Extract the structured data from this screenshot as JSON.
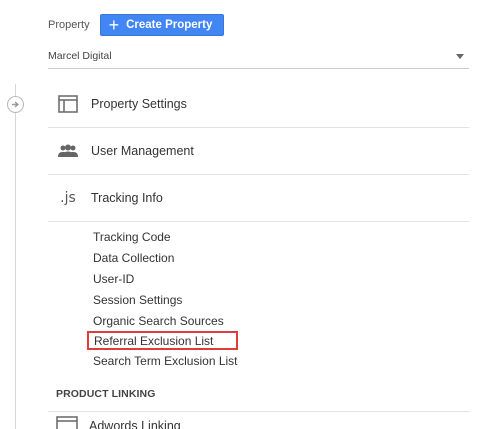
{
  "property": {
    "label": "Property",
    "create_button": "Create Property",
    "selected": "Marcel Digital"
  },
  "sections": [
    {
      "label": "Property Settings",
      "icon": "layout-icon"
    },
    {
      "label": "User Management",
      "icon": "people-icon"
    },
    {
      "label": "Tracking Info",
      "icon": "js-icon",
      "icon_text": ".js"
    }
  ],
  "tracking_items": [
    "Tracking Code",
    "Data Collection",
    "User-ID",
    "Session Settings",
    "Organic Search Sources",
    "Referral Exclusion List",
    "Search Term Exclusion List"
  ],
  "product_linking": {
    "heading": "PRODUCT LINKING",
    "first_item": "Adwords Linking"
  },
  "colors": {
    "accent": "#4285f4",
    "highlight": "#e03c3c"
  }
}
